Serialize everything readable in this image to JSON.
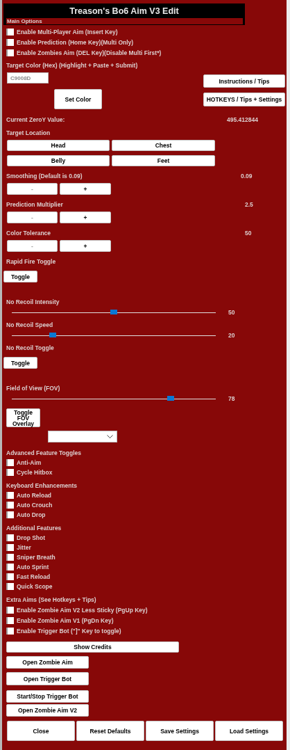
{
  "window": {
    "title": "Treason's Bo6 Aim V3 Edit"
  },
  "main_options": {
    "title": "Main Options",
    "checkboxes": [
      {
        "label": "Enable Multi-Player Aim (Insert Key)",
        "checked": false
      },
      {
        "label": "Enable Prediction (Home Key)(Multi Only)",
        "checked": false
      },
      {
        "label": "Enable Zombies Aim (DEL Key)(Disable Multi First*)",
        "checked": false
      }
    ]
  },
  "target_color": {
    "label": "Target Color (Hex) (Highlight + Paste + Submit)",
    "placeholder": "C9008D",
    "set_button": "Set Color"
  },
  "side_buttons": [
    "Instructions / Tips",
    "HOTKEYS / Tips + Settings"
  ],
  "zeroy": {
    "label": "Current ZeroY Value:",
    "value": "495.412844"
  },
  "target_location": {
    "label": "Target Location",
    "options": [
      "Head",
      "Chest",
      "Belly",
      "Feet"
    ]
  },
  "adjusters": [
    {
      "label": "Smoothing (Default is 0.09)",
      "value": "0.09",
      "minus": "-",
      "plus": "+"
    },
    {
      "label": "Prediction Multiplier",
      "value": "2.5",
      "minus": "-",
      "plus": "+"
    },
    {
      "label": "Color Tolerance",
      "value": "50",
      "minus": "-",
      "plus": "+"
    }
  ],
  "rapid_fire": {
    "label": "Rapid Fire Toggle",
    "button": "Toggle"
  },
  "recoil_sliders": [
    {
      "label": "No Recoil Intensity",
      "level": 0.5,
      "reading": "50"
    },
    {
      "label": "No Recoil Speed",
      "level": 0.2,
      "reading": "20"
    }
  ],
  "no_recoil_toggle": {
    "label": "No Recoil Toggle",
    "button": "Toggle"
  },
  "fov": {
    "label": "Field of View (FOV)",
    "level": 0.78,
    "reading": "78",
    "button": "Toggle FOV Overlay"
  },
  "groups": [
    {
      "title": "Advanced Feature Toggles",
      "items": [
        {
          "label": "Anti-Aim",
          "checked": false
        },
        {
          "label": "Cycle Hitbox",
          "checked": false
        }
      ]
    },
    {
      "title": "Keyboard Enhancements",
      "items": [
        {
          "label": "Auto Reload",
          "checked": false
        },
        {
          "label": "Auto Crouch",
          "checked": false
        },
        {
          "label": "Auto Drop",
          "checked": false
        }
      ]
    },
    {
      "title": "Additional Features",
      "items": [
        {
          "label": "Drop Shot",
          "checked": false
        },
        {
          "label": "Jitter",
          "checked": false
        },
        {
          "label": "Sniper Breath",
          "checked": false
        },
        {
          "label": "Auto Sprint",
          "checked": false
        },
        {
          "label": "Fast Reload",
          "checked": false
        },
        {
          "label": "Quick Scope",
          "checked": false
        }
      ]
    },
    {
      "title": "Extra Aims (See Hotkeys + Tips)",
      "items": [
        {
          "label": "Enable Zombie Aim V2 Less Sticky (PgUp Key)",
          "checked": false
        },
        {
          "label": "Enable Zombie Aim V1 (PgDn Key)",
          "checked": false
        },
        {
          "label": "Enable Trigger Bot (\"]\" Key to toggle)",
          "checked": false
        }
      ]
    }
  ],
  "show_credits": "Show Credits",
  "tool_buttons": [
    "Open Zombie Aim",
    "Open Trigger Bot",
    "Start/Stop Trigger Bot",
    "Open Zombie Aim V2"
  ],
  "bottom_buttons": [
    "Close",
    "Reset Defaults",
    "Save Settings",
    "Load Settings"
  ]
}
